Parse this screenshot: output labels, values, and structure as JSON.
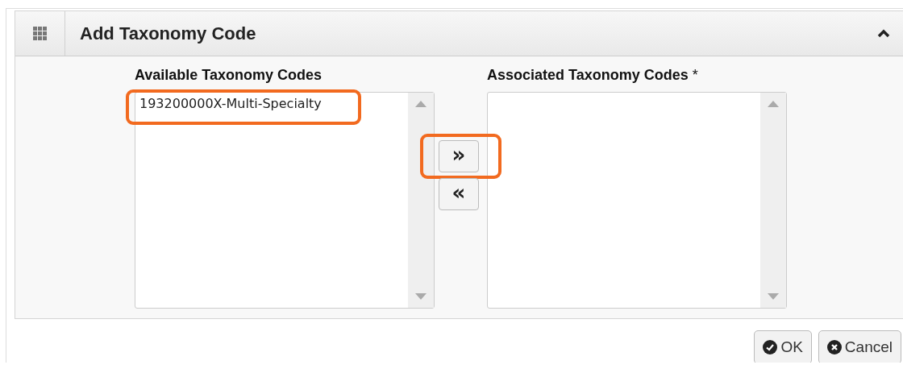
{
  "panel": {
    "title": "Add Taxonomy Code",
    "expanded": true
  },
  "available": {
    "label": "Available Taxonomy Codes",
    "options": [
      {
        "text": "193200000X-Multi-Specialty",
        "highlighted": true
      }
    ]
  },
  "move_buttons": [
    {
      "label": "»",
      "highlighted": true
    },
    {
      "label": "«",
      "highlighted": false
    }
  ],
  "associated": {
    "label": "Associated Taxonomy Codes",
    "required_mark": "*"
  },
  "buttons": [
    {
      "kind": "ok",
      "label": "OK"
    },
    {
      "kind": "cancel",
      "label": "Cancel"
    }
  ]
}
